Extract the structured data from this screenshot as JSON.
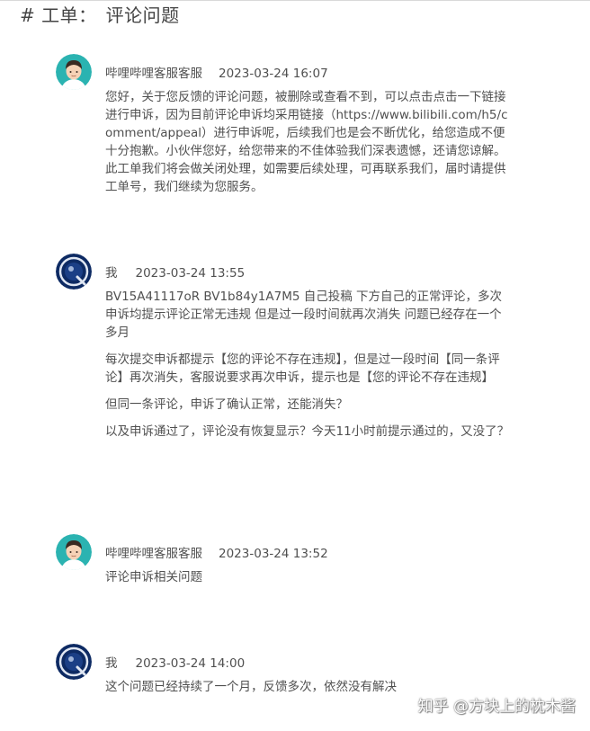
{
  "page": {
    "title_prefix": "# 工单：",
    "title_value": "评论问题"
  },
  "messages": [
    {
      "sender": "哔哩哔哩客服客服",
      "time": "2023-03-24 16:07",
      "avatar": "service-avatar-icon",
      "paragraphs": [
        "您好，关于您反馈的评论问题，被删除或查看不到，可以点击点击一下链接进行申诉，因为目前评论申诉均采用链接（https://www.bilibili.com/h5/comment/appeal）进行申诉呢，后续我们也是会不断优化，给您造成不便十分抱歉。小伙伴您好，给您带来的不佳体验我们深表遗憾，还请您谅解。此工单我们将会做关闭处理，如需要后续处理，可再联系我们，届时请提供工单号，我们继续为您服务。"
      ]
    },
    {
      "sender": "我",
      "time": "2023-03-24 13:55",
      "avatar": "user-avatar-icon",
      "paragraphs": [
        "BV15A41117oR BV1b84y1A7M5 自己投稿 下方自己的正常评论，多次申诉均提示评论正常无违规 但是过一段时间就再次消失 问题已经存在一个多月",
        "每次提交申诉都提示【您的评论不存在违规】，但是过一段时间【同一条评论】再次消失，客服说要求再次申诉，提示也是【您的评论不存在违规】",
        "但同一条评论，申诉了确认正常，还能消失？",
        "以及申诉通过了，评论没有恢复显示？今天11小时前提示通过的，又没了？"
      ]
    },
    {
      "sender": "哔哩哔哩客服客服",
      "time": "2023-03-24 13:52",
      "avatar": "service-avatar-icon",
      "paragraphs": [
        "评论申诉相关问题"
      ]
    },
    {
      "sender": "我",
      "time": "2023-03-24 14:00",
      "avatar": "user-avatar-icon",
      "paragraphs": [
        "这个问题已经持续了一个月，反馈多次，依然没有解决"
      ]
    }
  ],
  "watermark": "知乎 @方块上的枕木酱",
  "colors": {
    "text": "#505050",
    "service_avatar_bg": "#2bb3b1",
    "user_avatar_bg": "#0d2a63"
  }
}
